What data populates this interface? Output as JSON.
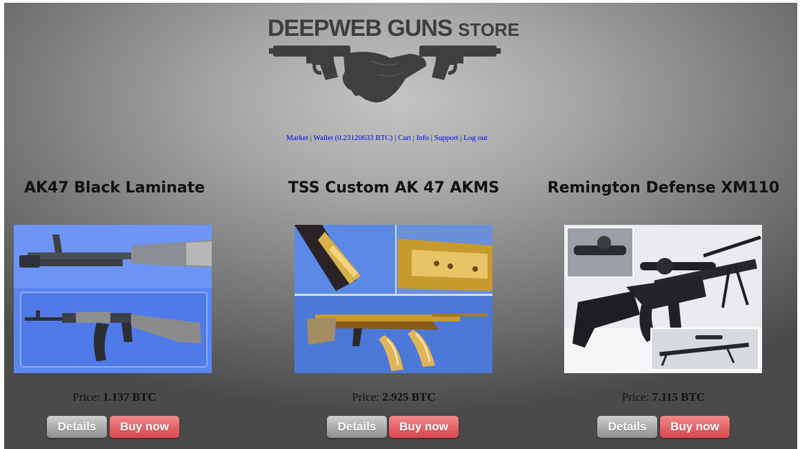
{
  "store": {
    "logo_word1": "DEEPWEB",
    "logo_word2": "GUNS",
    "logo_word3": "STORE"
  },
  "nav": {
    "items": [
      {
        "label": "Market"
      },
      {
        "label": "Wallet (0.23120633 BTC)"
      },
      {
        "label": "Cart"
      },
      {
        "label": "Info"
      },
      {
        "label": "Support"
      },
      {
        "label": "Log out"
      }
    ],
    "separator": " | "
  },
  "products": [
    {
      "title": "AK47 Black Laminate",
      "price_label": "Price:",
      "price": "1.137 BTC",
      "details_label": "Details",
      "buy_label": "Buy now",
      "image": "rifle-photo-ak47-laminate"
    },
    {
      "title": "TSS Custom AK 47 AKMS",
      "price_label": "Price:",
      "price": "2.925 BTC",
      "details_label": "Details",
      "buy_label": "Buy now",
      "image": "rifle-photo-gold-akms"
    },
    {
      "title": "Remington Defense XM110",
      "price_label": "Price:",
      "price": "7.115 BTC",
      "details_label": "Details",
      "buy_label": "Buy now",
      "image": "rifle-photo-xm110"
    }
  ],
  "colors": {
    "link": "#0000ee",
    "buy_button": "#e05a60",
    "details_button": "#a8a8a8"
  }
}
